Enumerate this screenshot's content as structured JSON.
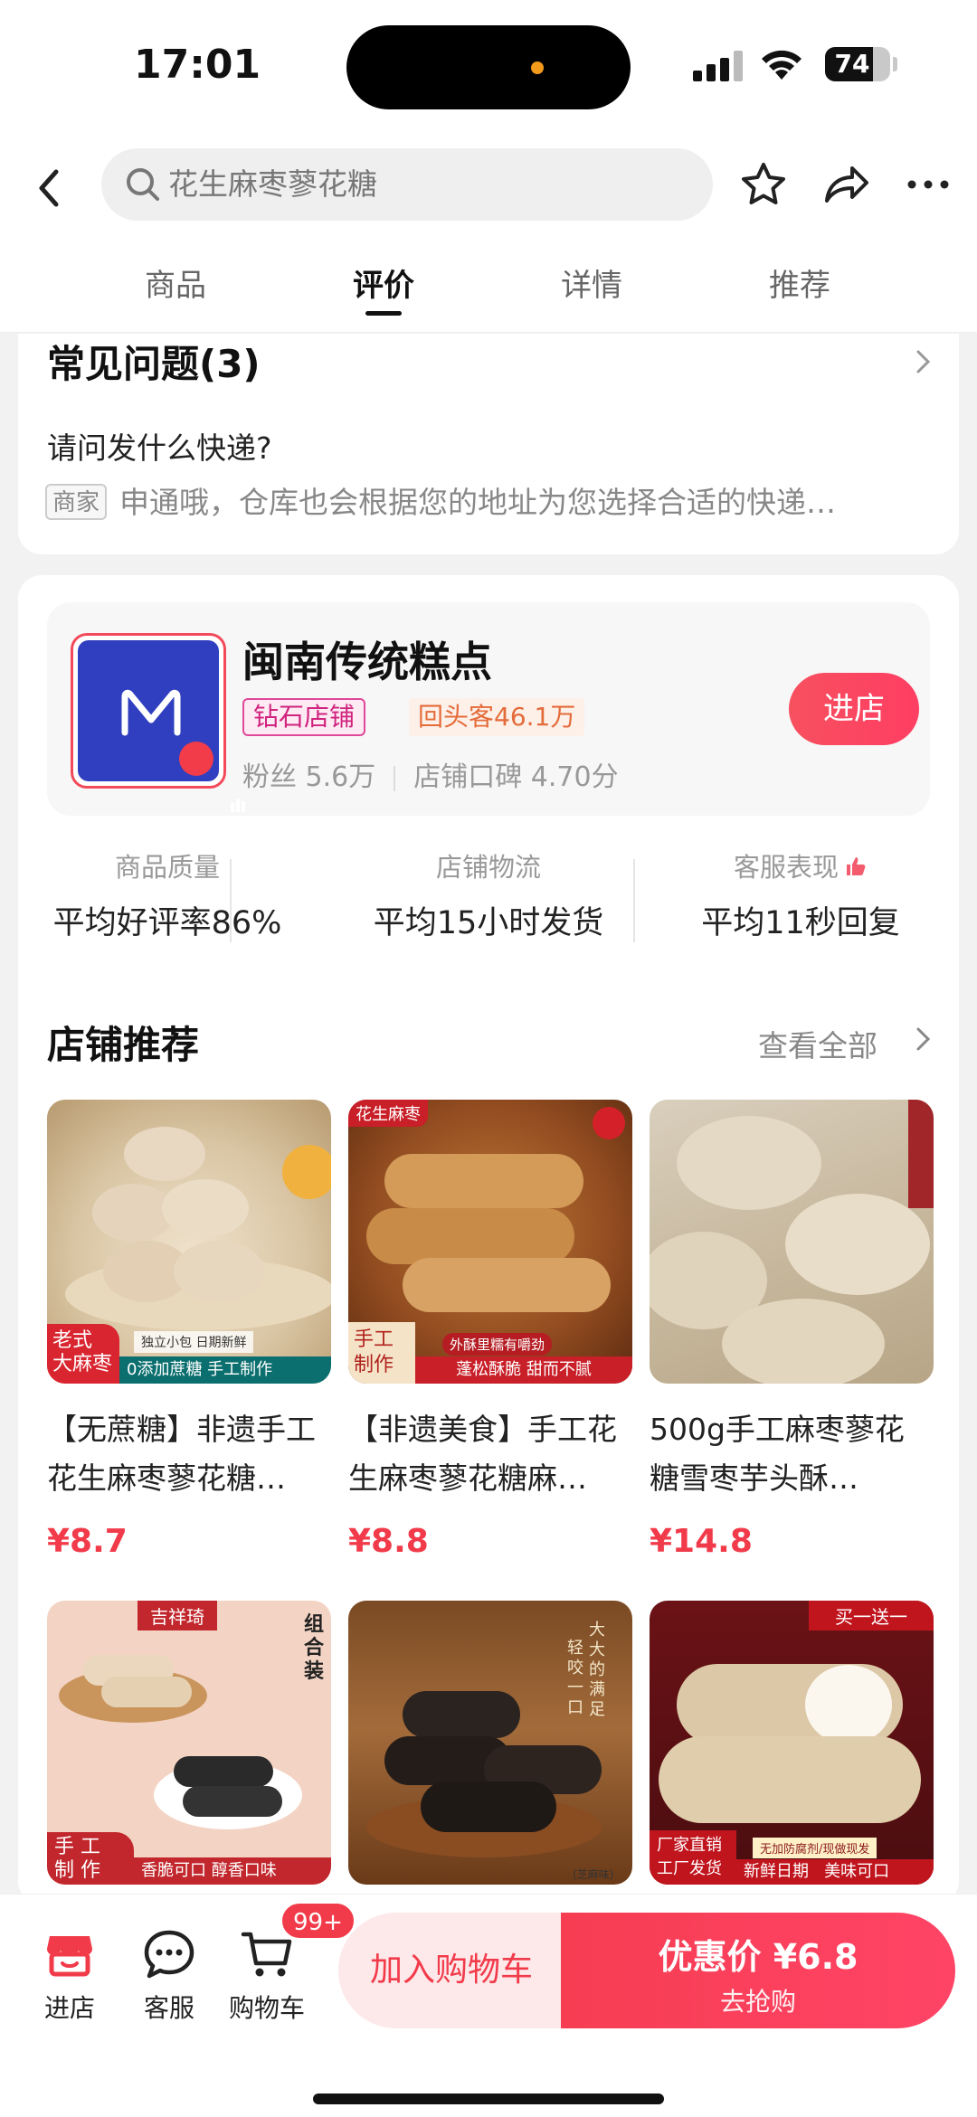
{
  "status": {
    "time": "17:01",
    "battery": "74",
    "battery_level": 0.74
  },
  "header": {
    "search_text": "花生麻枣蓼花糖",
    "tabs": [
      {
        "label": "商品"
      },
      {
        "label": "评价"
      },
      {
        "label": "详情"
      },
      {
        "label": "推荐"
      }
    ],
    "active_tab": "评价"
  },
  "faq": {
    "title": "常见问题(3)",
    "question": "请问发什么快递?",
    "answer_badge": "商家",
    "answer": "申通哦，仓库也会根据您的地址为您选择合适的快递…"
  },
  "store": {
    "name": "闽南传统糕点",
    "tag_level": "钻石店铺",
    "tag_returning": "回头客46.1万",
    "fans": "粉丝 5.6万",
    "rating": "店铺口碑 4.70分",
    "enter_label": "进店",
    "stats": [
      {
        "label": "商品质量",
        "value": "平均好评率86%"
      },
      {
        "label": "店铺物流",
        "value": "平均15小时发货"
      },
      {
        "label": "客服表现",
        "value": "平均11秒回复"
      }
    ]
  },
  "recommend": {
    "title": "店铺推荐",
    "see_all": "查看全部",
    "products": [
      {
        "name": "【无蔗糖】非遗手工花生麻枣蓼花糖…",
        "price": "¥8.7",
        "stickers": [
          "老式大麻枣",
          "独立小包 日期新鲜",
          "0添加蔗糖 手工制作"
        ]
      },
      {
        "name": "【非遗美食】手工花生麻枣蓼花糖麻…",
        "price": "¥8.8",
        "stickers": [
          "花生麻枣",
          "手工制作",
          "外酥里糯有嚼劲",
          "蓬松酥脆 甜而不腻"
        ]
      },
      {
        "name": "500g手工麻枣蓼花糖雪枣芋头酥…",
        "price": "¥14.8",
        "stickers": []
      },
      {
        "name": "",
        "price": "",
        "stickers": [
          "吉祥琦",
          "组合装",
          "手工制作",
          "香脆可口 醇香口味"
        ]
      },
      {
        "name": "",
        "price": "",
        "stickers": [
          "轻咬一口",
          "大大的满足",
          "(芝麻味)"
        ]
      },
      {
        "name": "",
        "price": "",
        "stickers": [
          "买一送一",
          "厂家直销",
          "工厂发货",
          "无加防腐剂/现做现发",
          "新鲜日期",
          "美味可口"
        ]
      }
    ]
  },
  "bottom": {
    "shop": "进店",
    "service": "客服",
    "cart": "购物车",
    "cart_badge": "99+",
    "add_cart": "加入购物车",
    "buy_price_label": "优惠价 ¥6.8",
    "buy_sub": "去抢购"
  },
  "colors": {
    "accent": "#f23b4a",
    "store_logo": "#2f3fbf"
  }
}
